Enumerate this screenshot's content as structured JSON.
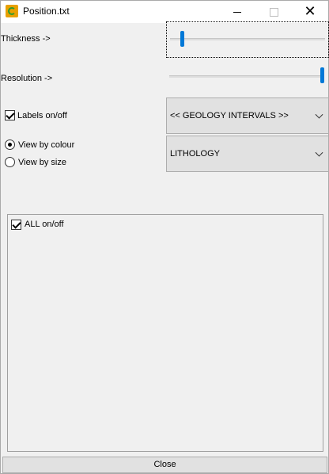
{
  "window": {
    "title": "Position.txt"
  },
  "titlebar": {
    "close_glyph": "✕"
  },
  "controls": {
    "thickness_label": "Thickness ->",
    "thickness_value": 0.07,
    "resolution_label": "Resolution ->",
    "resolution_value": 1.0,
    "labels_checkbox_label": "Labels on/off",
    "labels_checked": true,
    "view_by_colour_label": "View by colour",
    "view_by_size_label": "View by size",
    "view_mode_selected": "View by colour",
    "intervals_dropdown_value": "<< GEOLOGY INTERVALS >>",
    "property_dropdown_value": "LITHOLOGY"
  },
  "panel": {
    "all_checkbox_label": "ALL on/off",
    "all_checked": true
  },
  "footer": {
    "close_button_label": "Close"
  },
  "colors": {
    "accent": "#0078d7",
    "background": "#f0f0f0",
    "button_face": "#e1e1e1"
  }
}
